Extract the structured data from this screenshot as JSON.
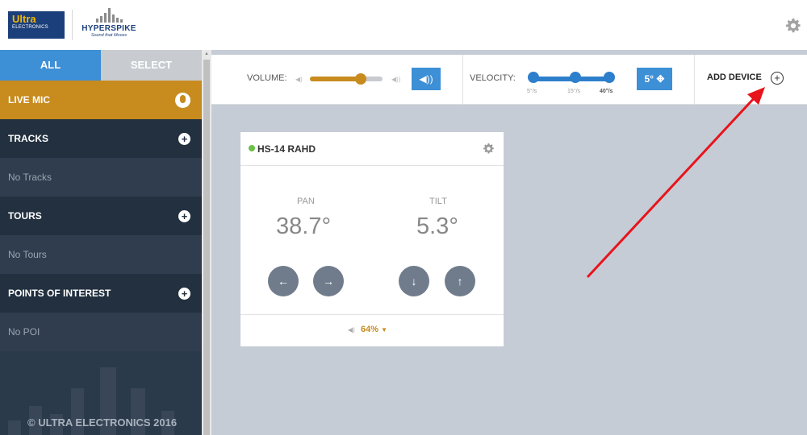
{
  "header": {
    "brand_ultra": "Ultra",
    "brand_ultra_sub": "ELECTRONICS",
    "product_name": "HYPERSPIKE",
    "product_tagline": "Sound that Moves",
    "settings_icon": "gear-icon"
  },
  "sidebar": {
    "tabs": [
      {
        "label": "ALL",
        "active": true
      },
      {
        "label": "SELECT",
        "active": false
      }
    ],
    "live_mic": {
      "label": "LIVE MIC",
      "icon": "microphone-icon"
    },
    "sections": [
      {
        "label": "TRACKS",
        "empty_text": "No Tracks"
      },
      {
        "label": "TOURS",
        "empty_text": "No Tours"
      },
      {
        "label": "POINTS OF INTEREST",
        "empty_text": "No POI"
      }
    ],
    "copyright": "© ULTRA ELECTRONICS 2016"
  },
  "toolbar": {
    "volume_label": "VOLUME:",
    "volume_level": 0.7,
    "velocity_label": "VELOCITY:",
    "velocity_ticks": [
      "5°/s",
      "15°/s",
      "40°/s"
    ],
    "velocity_step": "5°",
    "add_device_label": "ADD DEVICE"
  },
  "device": {
    "name": "HS-14 RAHD",
    "status_color": "#6cc04a",
    "pan_label": "PAN",
    "pan_value": "38.7°",
    "tilt_label": "TILT",
    "tilt_value": "5.3°",
    "volume_percent": "64%",
    "buttons": [
      "pan-left",
      "pan-right",
      "tilt-down",
      "tilt-up"
    ]
  },
  "colors": {
    "accent_gold": "#c88b1e",
    "accent_blue": "#3d8fd6",
    "sidebar_dark": "#22303f",
    "annotation_arrow": "#e8141b"
  }
}
